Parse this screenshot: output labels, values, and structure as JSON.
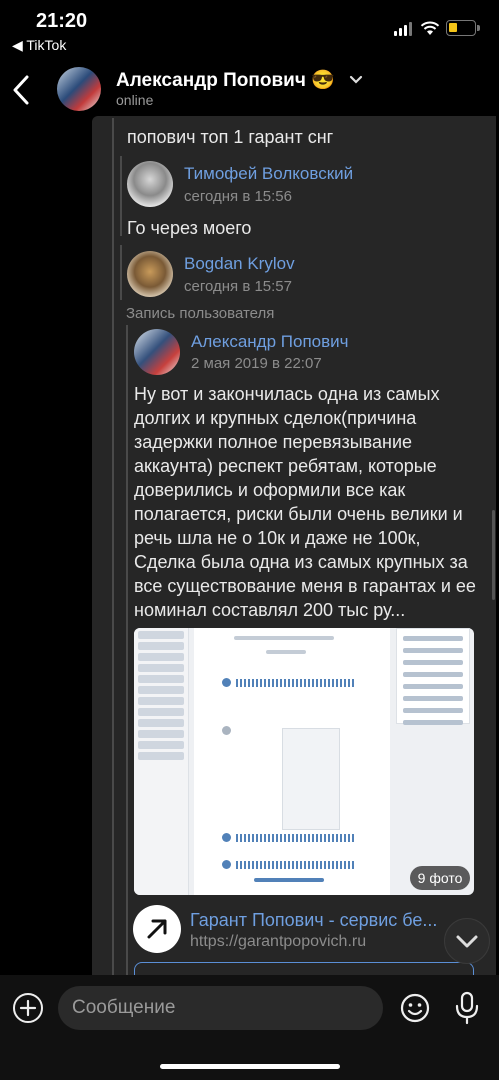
{
  "status_bar": {
    "time": "21:20",
    "back_app": "◀ TikTok"
  },
  "header": {
    "name": "Александр Попович 😎",
    "status": "online"
  },
  "chat": {
    "top_text": "попович топ 1 гарант снг",
    "fwd1": {
      "author": "Тимофей Волковский",
      "date": "сегодня в 15:56",
      "text": "Го через моего"
    },
    "fwd2": {
      "author": "Bogdan Krylov",
      "date": "сегодня в 15:57",
      "caption": "Запись пользователя"
    },
    "fwd3": {
      "author": "Александр Попович",
      "date": "2 мая 2019 в 22:07",
      "text": "Ну вот и закончилась одна из самых долгих и крупных сделок(причина задержки полное перевязывание аккаунта) респект ребятам, которые доверились и оформили все как полагается, риски были очень велики и речь шла не о 10к и даже не 100к, Сделка была одна из самых крупных за все существование меня в гарантах и ее номинал составлял 200 тыс ру..."
    },
    "photo_badge": "9 фото",
    "link": {
      "title": "Гарант Попович - сервис бе...",
      "url": "https://garantpopovich.ru"
    }
  },
  "input": {
    "placeholder": "Сообщение"
  },
  "colors": {
    "accent": "#6f9fe0",
    "bubble": "#262626",
    "background": "#000000"
  },
  "icons": [
    "back-arrow-icon",
    "chevron-down-icon",
    "plus-icon",
    "emoji-icon",
    "microphone-icon",
    "link-arrow-icon",
    "scroll-down-icon"
  ]
}
